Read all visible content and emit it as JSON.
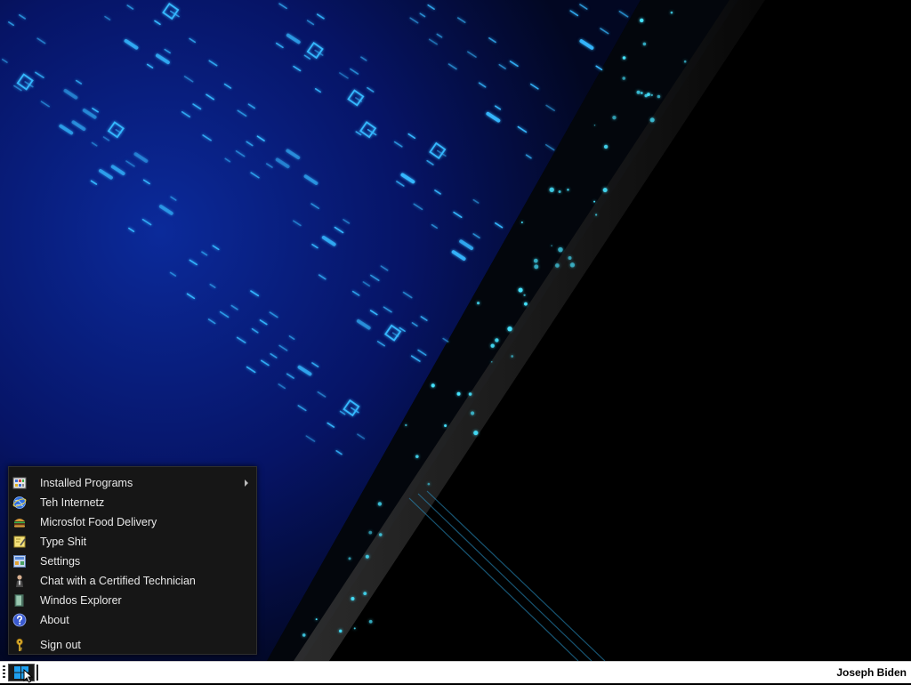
{
  "start_menu": {
    "items": [
      {
        "label": "Installed Programs",
        "icon": "programs-grid-icon",
        "has_submenu": true
      },
      {
        "label": "Teh Internetz",
        "icon": "globe-icon"
      },
      {
        "label": "Microsfot Food Delivery",
        "icon": "burger-icon"
      },
      {
        "label": "Type Shit",
        "icon": "notepad-icon"
      },
      {
        "label": "Settings",
        "icon": "control-panel-icon"
      },
      {
        "label": "Chat with a Certified Technician",
        "icon": "technician-icon"
      },
      {
        "label": "Windos Explorer",
        "icon": "explorer-icon"
      },
      {
        "label": "About",
        "icon": "help-question-icon"
      },
      {
        "label": "Sign out",
        "icon": "key-icon"
      }
    ]
  },
  "taskbar": {
    "start_icon": "windows-logo-icon",
    "user_name": "Joseph Biden"
  },
  "colors": {
    "wallpaper_glow": "#2aa8ff",
    "wallpaper_blue": "#0a1a6a",
    "menu_bg": "#161616",
    "taskbar_bg": "#ffffff"
  }
}
